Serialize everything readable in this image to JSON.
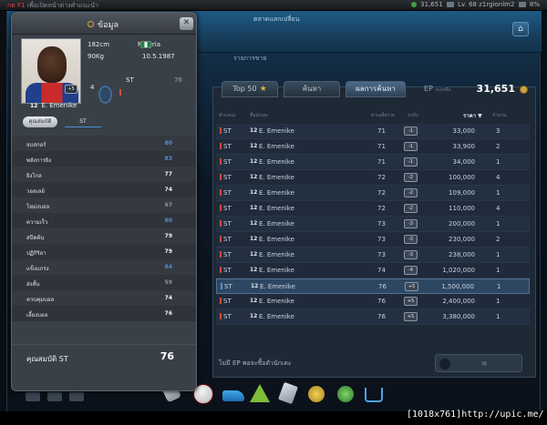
{
  "topbar": {
    "hint": "กด F1 เพื่อเปิดหน้าต่างคำแนะนำ",
    "ep": "31,651",
    "level": "Lv. 68 z1rgionlm2",
    "volume": "8%"
  },
  "header": {
    "title": "ตลาดแลกเปลี่ยน",
    "subtab": "รายการขาย"
  },
  "market": {
    "tabs": [
      "Top 50",
      "ค้นหา",
      "ผลการค้นหา"
    ],
    "ep_label": "EP",
    "ep_sub": "คงเหลือ",
    "ep_value": "31,651",
    "columns": {
      "pos": "ตำแหน่ง",
      "name": "ชื่อนักเตะ",
      "ovr": "ค่าเฉลี่ยรวม",
      "level": "ระดับ",
      "price": "ราคา ▼",
      "qty": "จำนวน"
    },
    "rows": [
      {
        "pos": "ST",
        "team": "12",
        "name": "E. Emenike",
        "ovr": "71",
        "level": "-1",
        "price": "33,000",
        "qty": "3"
      },
      {
        "pos": "ST",
        "team": "12",
        "name": "E. Emenike",
        "ovr": "71",
        "level": "-1",
        "price": "33,900",
        "qty": "2"
      },
      {
        "pos": "ST",
        "team": "12",
        "name": "E. Emenike",
        "ovr": "71",
        "level": "-1",
        "price": "34,000",
        "qty": "1"
      },
      {
        "pos": "ST",
        "team": "12",
        "name": "E. Emenike",
        "ovr": "72",
        "level": "-2",
        "price": "100,000",
        "qty": "4"
      },
      {
        "pos": "ST",
        "team": "12",
        "name": "E. Emenike",
        "ovr": "72",
        "level": "-2",
        "price": "109,000",
        "qty": "1"
      },
      {
        "pos": "ST",
        "team": "12",
        "name": "E. Emenike",
        "ovr": "72",
        "level": "-2",
        "price": "110,000",
        "qty": "4"
      },
      {
        "pos": "ST",
        "team": "12",
        "name": "E. Emenike",
        "ovr": "73",
        "level": "-3",
        "price": "200,000",
        "qty": "1"
      },
      {
        "pos": "ST",
        "team": "12",
        "name": "E. Emenike",
        "ovr": "73",
        "level": "-3",
        "price": "230,000",
        "qty": "2"
      },
      {
        "pos": "ST",
        "team": "12",
        "name": "E. Emenike",
        "ovr": "73",
        "level": "-3",
        "price": "238,000",
        "qty": "1"
      },
      {
        "pos": "ST",
        "team": "12",
        "name": "E. Emenike",
        "ovr": "74",
        "level": "-4",
        "price": "1,020,000",
        "qty": "1"
      },
      {
        "pos": "ST",
        "team": "12",
        "name": "E. Emenike",
        "ovr": "76",
        "level": "+5",
        "price": "1,500,000",
        "qty": "1",
        "selected": true
      },
      {
        "pos": "ST",
        "team": "12",
        "name": "E. Emenike",
        "ovr": "76",
        "level": "+5",
        "price": "2,400,000",
        "qty": "1"
      },
      {
        "pos": "ST",
        "team": "12",
        "name": "E. Emenike",
        "ovr": "76",
        "level": "+5",
        "price": "3,380,000",
        "qty": "1"
      }
    ],
    "footer_msg": "ไม่มี EP พอจะซื้อตัวนักเตะ"
  },
  "modal": {
    "title": "ข้อมูล",
    "close": "✕",
    "player": {
      "height": "182cm",
      "weight": "90Kg",
      "nation": "Nigeria",
      "dob": "10.5.1987",
      "number": "4",
      "pos": "ST",
      "ovr": "76",
      "level": "+5",
      "team": "12",
      "name": "E. Emenike"
    },
    "tab_attr": "คุณสมบัติ",
    "tab_pos": "ST",
    "stats": [
      {
        "label": "จบสกอร์",
        "value": "80",
        "color": "#4f8fd6"
      },
      {
        "label": "พลังการยิง",
        "value": "83",
        "color": "#4f8fd6"
      },
      {
        "label": "ยิงไกล",
        "value": "77",
        "color": "#eef1f4"
      },
      {
        "label": "วอลเลย์",
        "value": "74",
        "color": "#eef1f4"
      },
      {
        "label": "โหม่งบอล",
        "value": "67",
        "color": "#8e959c"
      },
      {
        "label": "ความเร็ว",
        "value": "80",
        "color": "#4f8fd6"
      },
      {
        "label": "สปีดต้น",
        "value": "79",
        "color": "#eef1f4"
      },
      {
        "label": "ปฏิกิริยา",
        "value": "79",
        "color": "#eef1f4"
      },
      {
        "label": "แข็งแกร่ง",
        "value": "84",
        "color": "#4f8fd6"
      },
      {
        "label": "ส่งสั้น",
        "value": "59",
        "color": "#8e959c"
      },
      {
        "label": "ควบคุมบอล",
        "value": "74",
        "color": "#eef1f4"
      },
      {
        "label": "เลี้ยงบอล",
        "value": "76",
        "color": "#eef1f4"
      }
    ],
    "summary_label": "คุณสมบัติ ST",
    "summary_value": "76"
  },
  "watermark": "[1018x761]http://upic.me/"
}
